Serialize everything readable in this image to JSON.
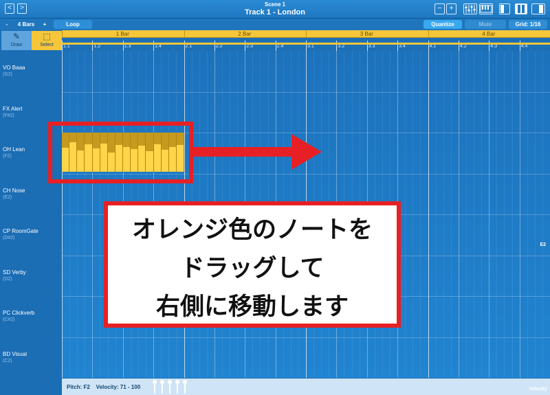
{
  "header": {
    "scene": "Scene 1",
    "track_title": "Track 1 - London",
    "back_glyph": "<",
    "forward_glyph": ">"
  },
  "toolbar": {
    "minus": "-",
    "length": "4 Bars",
    "plus": "+",
    "loop": "Loop",
    "quantize": "Quantize",
    "mute": "Mute",
    "grid": "Grid: 1/16"
  },
  "tools": {
    "draw": "Draw",
    "select": "Select"
  },
  "ruler": {
    "bars": [
      "1 Bar",
      "2 Bar",
      "3 Bar",
      "4 Bar"
    ],
    "beats": [
      "1.1",
      "1.2",
      "1.3",
      "1.4",
      "2.1",
      "2.2",
      "2.3",
      "2.4",
      "3.1",
      "3.2",
      "3.3",
      "3.4",
      "4.1",
      "4.2",
      "4.3",
      "4.4"
    ]
  },
  "tracks": [
    {
      "name": "VO Baaa",
      "note": "(G2)"
    },
    {
      "name": "FX Alert",
      "note": "(F#2)"
    },
    {
      "name": "OH Lean",
      "note": "(F2)"
    },
    {
      "name": "CH Nose",
      "note": "(E2)"
    },
    {
      "name": "CP RoomGate",
      "note": "(D#2)"
    },
    {
      "name": "SD Verby",
      "note": "(D2)"
    },
    {
      "name": "PC Clickverb",
      "note": "(C#2)"
    },
    {
      "name": "BD Visual",
      "note": "(C2)"
    }
  ],
  "grid_marker": "E2",
  "notes": {
    "count": 16,
    "velocity_fractions": [
      0.62,
      0.75,
      0.55,
      0.7,
      0.6,
      0.72,
      0.5,
      0.68,
      0.64,
      0.58,
      0.66,
      0.52,
      0.71,
      0.57,
      0.63,
      0.69
    ]
  },
  "caption": {
    "line1": "オレンジ色のノートを",
    "line2": "ドラッグして",
    "line3": "右側に移動します"
  },
  "status": {
    "pitch": "Pitch: F2",
    "velocity": "Velocity: 71 - 100",
    "velocity_tag": "Velocity"
  },
  "colors": {
    "accent_yellow": "#f5c63a",
    "annotation_red": "#e62024",
    "background_blue": "#1a6fb8"
  }
}
